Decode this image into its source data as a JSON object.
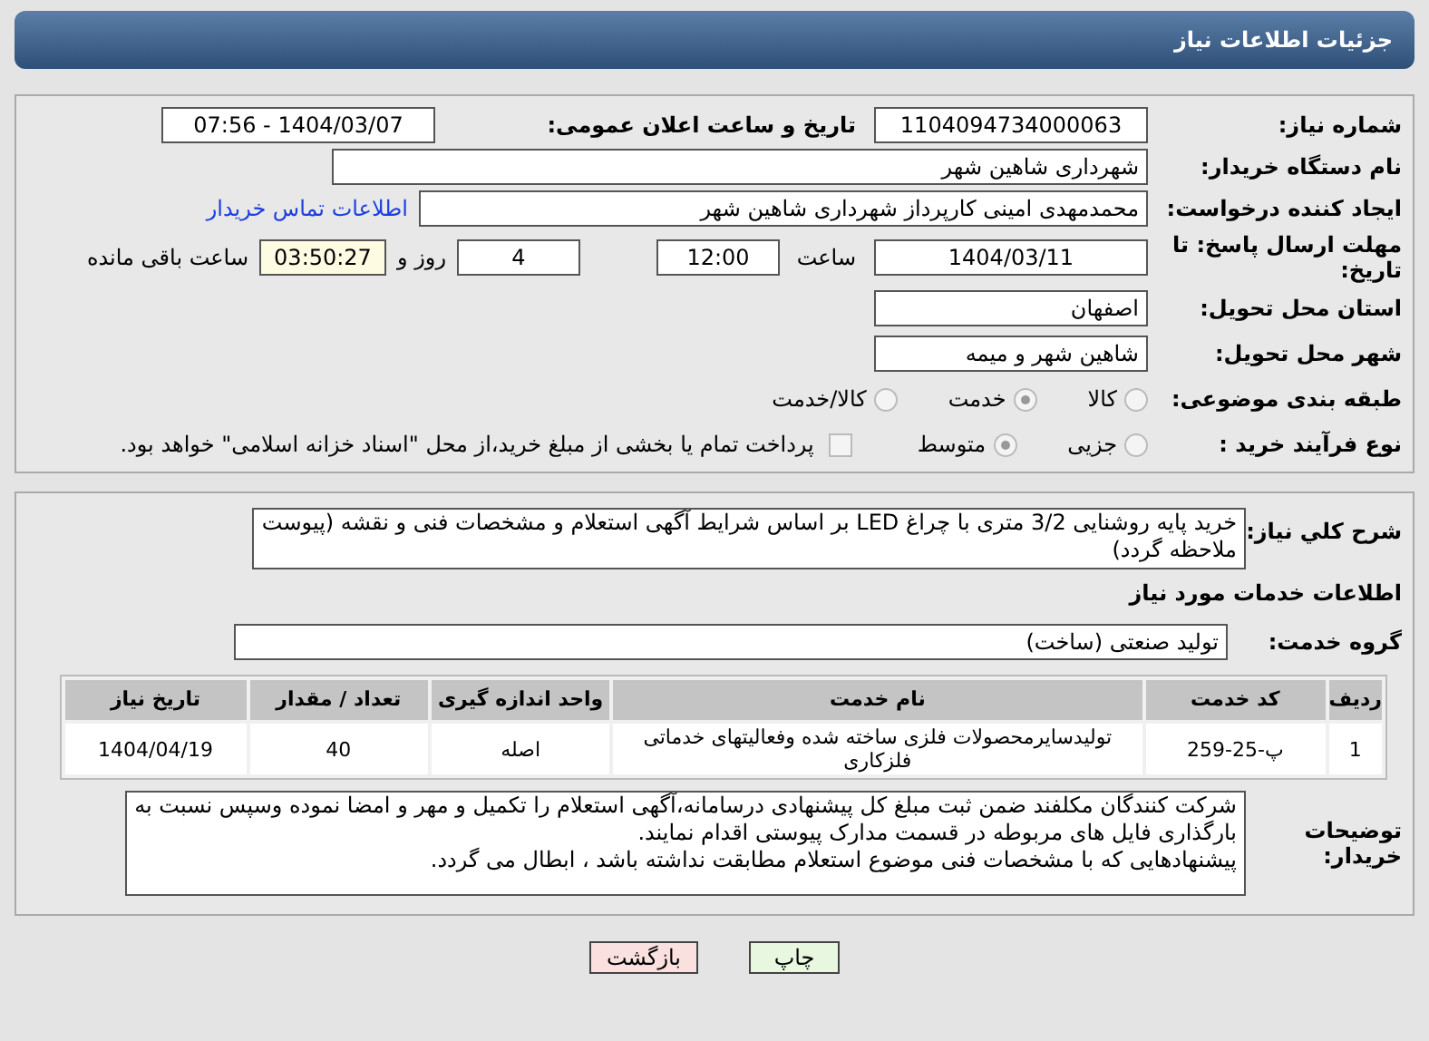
{
  "header": {
    "title": "جزئیات اطلاعات نیاز"
  },
  "need_number": {
    "label": "شماره نیاز:",
    "value": "1104094734000063"
  },
  "announce": {
    "label": "تاریخ و ساعت اعلان عمومی:",
    "value": "1404/03/07 - 07:56"
  },
  "buyer_org": {
    "label": "نام دستگاه خریدار:",
    "value": "شهرداری شاهین شهر"
  },
  "requester": {
    "label": "ایجاد کننده درخواست:",
    "value": "محمدمهدی امینی کارپرداز شهرداری شاهین شهر",
    "link": "اطلاعات تماس خریدار"
  },
  "deadline": {
    "label": "مهلت ارسال پاسخ: تا تاریخ:",
    "date": "1404/03/11",
    "time_label": "ساعت",
    "time": "12:00",
    "days": "4",
    "days_label": "روز و",
    "remaining": "03:50:27",
    "remaining_label": "ساعت باقی مانده"
  },
  "province": {
    "label": "استان محل تحویل:",
    "value": "اصفهان"
  },
  "city": {
    "label": "شهر محل تحویل:",
    "value": "شاهین شهر و میمه"
  },
  "category": {
    "label": "طبقه بندی موضوعی:",
    "options": [
      {
        "label": "کالا",
        "selected": false
      },
      {
        "label": "خدمت",
        "selected": true
      },
      {
        "label": "کالا/خدمت",
        "selected": false
      }
    ]
  },
  "process": {
    "label": "نوع فرآیند خرید :",
    "options": [
      {
        "label": "جزیی",
        "selected": false
      },
      {
        "label": "متوسط",
        "selected": true
      }
    ],
    "payment": {
      "label": "پرداخت تمام یا بخشی از مبلغ خرید،از محل \"اسناد خزانه اسلامی\" خواهد بود.",
      "checked": false
    }
  },
  "description": {
    "label": "شرح کلي نياز:",
    "value": "خرید پایه روشنایی 3/2 متری با چراغ LED  بر اساس شرایط آگهی استعلام و مشخصات فنی و نقشه (پیوست ملاحظه گردد)"
  },
  "services_title": "اطلاعات خدمات مورد نیاز",
  "service_group": {
    "label": "گروه خدمت:",
    "value": "تولید صنعتی (ساخت)"
  },
  "table": {
    "columns": [
      "ردیف",
      "کد خدمت",
      "نام خدمت",
      "واحد اندازه گیری",
      "تعداد / مقدار",
      "تاریخ نیاز"
    ],
    "rows": [
      [
        "1",
        "پ-25-259",
        "تولیدسایرمحصولات فلزی ساخته شده وفعالیتهای خدماتی فلزکاری",
        "اصله",
        "40",
        "1404/04/19"
      ]
    ]
  },
  "buyer_notes": {
    "label": "توضیحات خریدار:",
    "value": "شرکت کنندگان مکلفند ضمن ثبت مبلغ کل پیشنهادی درسامانه،آگهی استعلام را  تکمیل و مهر و امضا نموده وسپس نسبت به بارگذاری فایل های مربوطه در قسمت مدارک پیوستی اقدام نمایند.\nپیشنهادهایی که با مشخصات فنی موضوع استعلام مطابقت نداشته باشد ، ابطال می گردد."
  },
  "buttons": [
    {
      "label": "چاپ",
      "kind": "print"
    },
    {
      "label": "بازگشت",
      "kind": "back"
    }
  ]
}
